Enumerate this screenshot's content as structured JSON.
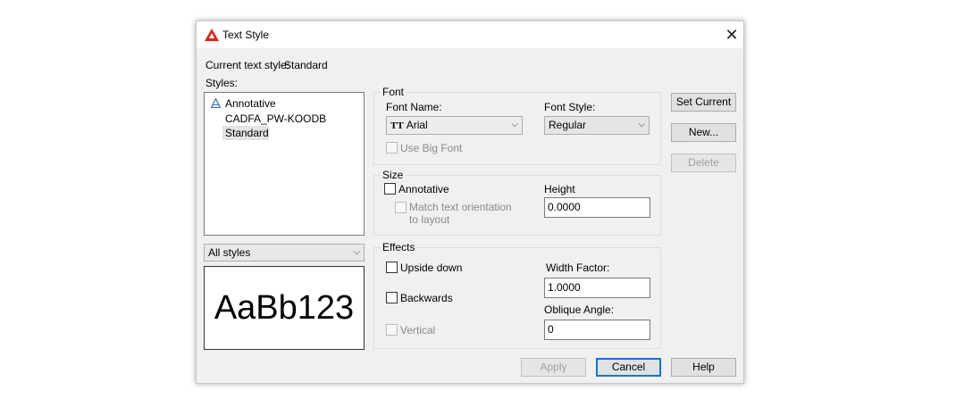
{
  "window": {
    "title": "Text Style",
    "close_label": "✕"
  },
  "current_style": {
    "label": "Current text style:",
    "value": "Standard"
  },
  "styles": {
    "label": "Styles:",
    "items": [
      {
        "name": "Annotative",
        "icon": "annotative-icon"
      },
      {
        "name": "CADFA_PW-KOODB"
      },
      {
        "name": "Standard",
        "selected": true
      }
    ]
  },
  "filter": {
    "value": "All styles"
  },
  "preview": {
    "text": "AaBb123"
  },
  "font": {
    "group_label": "Font",
    "font_name_label": "Font Name:",
    "font_name_value": "Arial",
    "font_style_label": "Font Style:",
    "font_style_value": "Regular",
    "big_font_label": "Use Big Font"
  },
  "size": {
    "group_label": "Size",
    "annotative_label": "Annotative",
    "match_label_line1": "Match text orientation",
    "match_label_line2": "to layout",
    "height_label": "Height",
    "height_value": "0.0000"
  },
  "effects": {
    "group_label": "Effects",
    "upside_down_label": "Upside down",
    "backwards_label": "Backwards",
    "vertical_label": "Vertical",
    "width_factor_label": "Width Factor:",
    "width_factor_value": "1.0000",
    "oblique_label": "Oblique Angle:",
    "oblique_value": "0"
  },
  "buttons": {
    "set_current": "Set Current",
    "new": "New...",
    "delete": "Delete",
    "apply": "Apply",
    "cancel": "Cancel",
    "help": "Help"
  },
  "colors": {
    "accent": "#0078d7",
    "app_icon": "#d0281c"
  }
}
